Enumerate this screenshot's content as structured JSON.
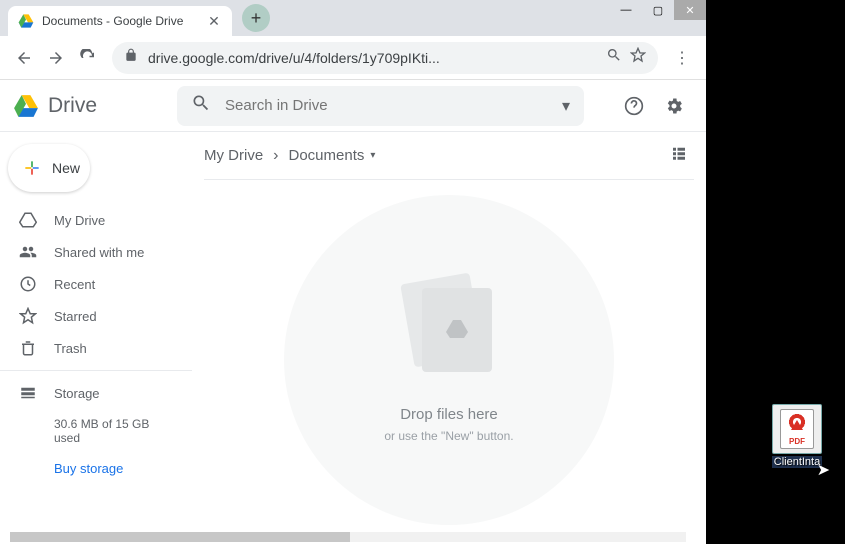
{
  "browser": {
    "tab_title": "Documents - Google Drive",
    "url": "drive.google.com/drive/u/4/folders/1y709pIKti..."
  },
  "drive": {
    "app_name": "Drive",
    "search_placeholder": "Search in Drive",
    "new_button": "New",
    "sidebar": [
      {
        "label": "My Drive",
        "icon": "drive-icon"
      },
      {
        "label": "Shared with me",
        "icon": "shared-icon"
      },
      {
        "label": "Recent",
        "icon": "recent-icon"
      },
      {
        "label": "Starred",
        "icon": "starred-icon"
      },
      {
        "label": "Trash",
        "icon": "trash-icon"
      }
    ],
    "storage_label": "Storage",
    "storage_used": "30.6 MB of 15 GB used",
    "buy_storage": "Buy storage",
    "breadcrumb": [
      "My Drive",
      "Documents"
    ],
    "drop_title": "Drop files here",
    "drop_sub": "or use the \"New\" button."
  },
  "desktop": {
    "file_name": "ClientInta",
    "file_type": "PDF"
  }
}
